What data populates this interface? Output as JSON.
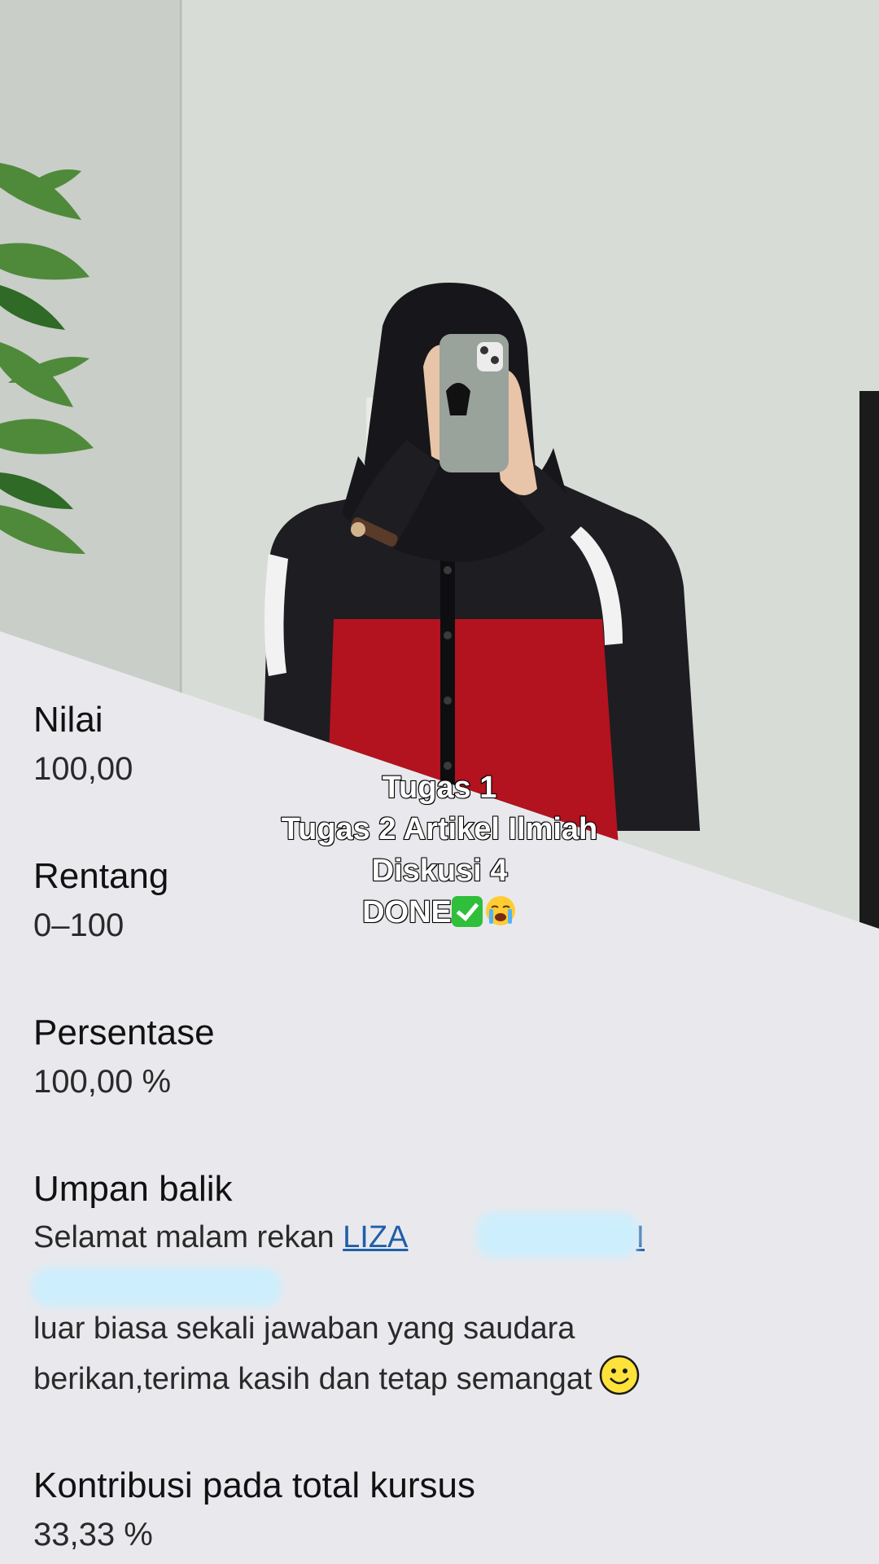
{
  "photo": {
    "wall_color": "#d7dbd6",
    "jacket_red": "#b3121f",
    "jacket_black": "#1d1d22",
    "hijab_color": "#17171b"
  },
  "grade": {
    "nilai": {
      "label": "Nilai",
      "value": "100,00"
    },
    "rentang": {
      "label": "Rentang",
      "value": "0–100"
    },
    "persentase": {
      "label": "Persentase",
      "value": "100,00 %"
    },
    "umpan_balik": {
      "label": "Umpan balik",
      "greeting": "Selamat malam rekan ",
      "name_link": "LIZA",
      "name_link_tail": "I",
      "line2": "luar biasa sekali jawaban yang saudara",
      "line3": "berikan,terima kasih dan tetap semangat",
      "emoji_icon": "smiley-face-icon"
    },
    "kontribusi": {
      "label": "Kontribusi pada total kursus",
      "value": "33,33 %"
    }
  },
  "caption": {
    "line1": "Tugas 1",
    "line2": "Tugas 2 Artikel Ilmiah",
    "line3": "Diskusi 4",
    "line4": "DONE",
    "emoji_icons": [
      "check-mark-icon",
      "crying-face-icon"
    ]
  },
  "colors": {
    "panel_bg": "#e9e9ed",
    "link": "#1f5fa8",
    "redaction": "#cdeefc"
  }
}
